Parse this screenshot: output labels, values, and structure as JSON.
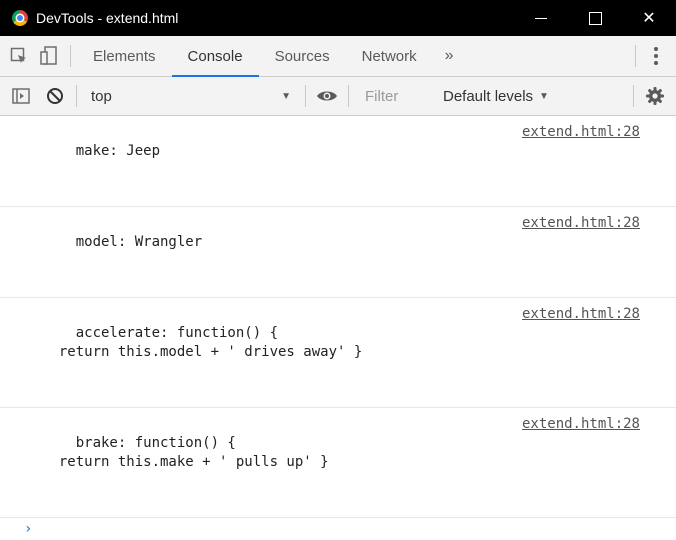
{
  "window": {
    "title": "DevTools - extend.html",
    "minimize_glyph": "—",
    "maximize_glyph": "☐",
    "close_glyph": "✕"
  },
  "tabs": [
    {
      "label": "Elements",
      "active": false
    },
    {
      "label": "Console",
      "active": true
    },
    {
      "label": "Sources",
      "active": false
    },
    {
      "label": "Network",
      "active": false
    }
  ],
  "tabbar": {
    "more_glyph": "»"
  },
  "toolbar": {
    "context": "top",
    "filter_placeholder": "Filter",
    "levels_label": "Default levels",
    "levels_arrow": "▼",
    "context_arrow": "▼"
  },
  "console": {
    "messages": [
      {
        "text": "make: Jeep",
        "source": "extend.html:28"
      },
      {
        "text": "model: Wrangler",
        "source": "extend.html:28"
      },
      {
        "text": "accelerate: function() {\n  return this.model + ' drives away' }",
        "source": "extend.html:28"
      },
      {
        "text": "brake: function() {\n  return this.make + ' pulls up' }",
        "source": "extend.html:28"
      }
    ],
    "prompt": "›"
  },
  "icons": {
    "inspect": "inspect-element-icon",
    "device": "device-toolbar-icon",
    "sidebar": "show-sidebar-icon",
    "clear": "clear-console-icon",
    "eye": "live-expression-icon",
    "gear": "settings-gear-icon",
    "menu": "more-options-icon"
  },
  "colors": {
    "accent": "#1a73e8",
    "titlebar": "#000000",
    "toolbar": "#f3f3f3"
  }
}
